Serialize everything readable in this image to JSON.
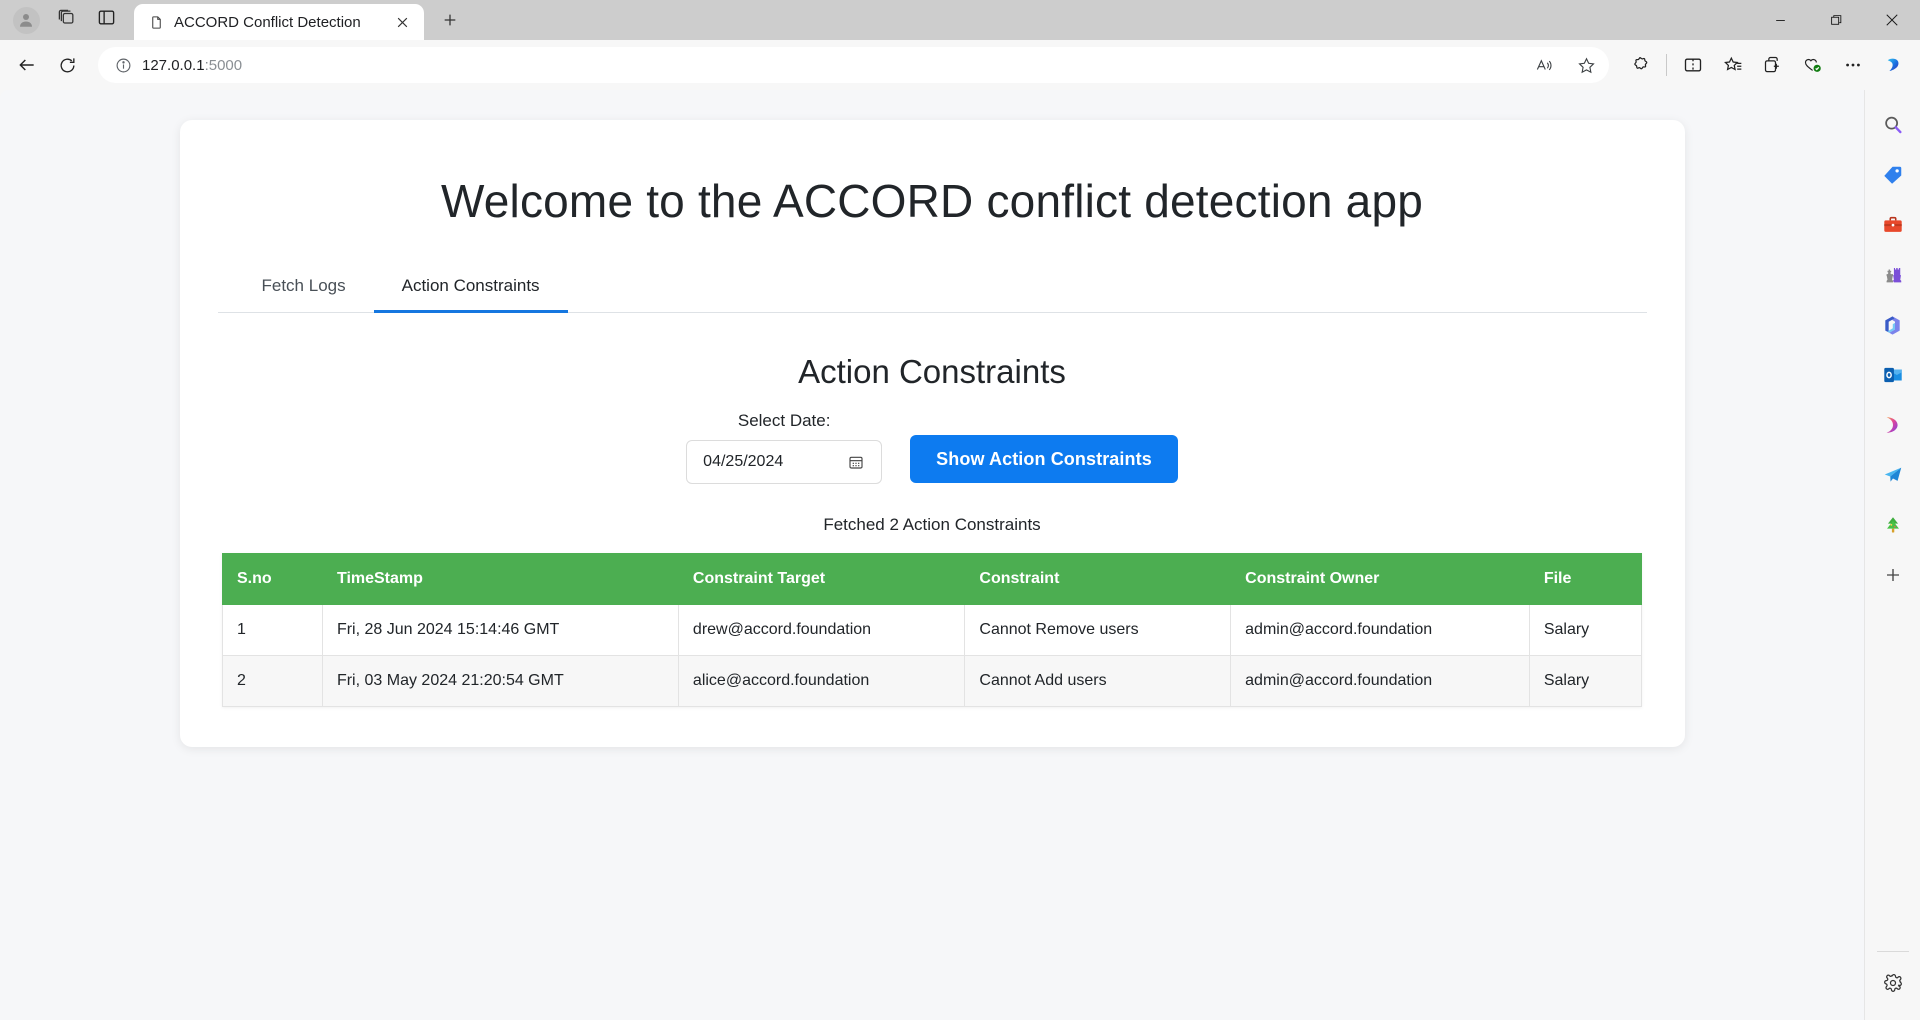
{
  "browser": {
    "window_controls": {
      "minimize": "minimize-icon",
      "restore": "restore-icon",
      "close": "close-icon"
    },
    "tab": {
      "title": "ACCORD Conflict Detection",
      "favicon": "page-icon",
      "close": "close-icon"
    },
    "new_tab": "+",
    "left_chips": [
      "profile-avatar-icon",
      "workspaces-icon",
      "tab-actions-icon"
    ],
    "nav": {
      "back": "back-arrow-icon",
      "refresh": "refresh-icon"
    },
    "address": {
      "url_main": "127.0.0.1",
      "url_port": ":5000",
      "info_icon": "site-info-icon"
    },
    "omnibox_actions": [
      "read-aloud-icon",
      "favorite-star-icon"
    ],
    "toolbar_actions": [
      "copilot-puzzle-icon",
      "split-screen-icon",
      "favorites-icon",
      "collections-icon",
      "browser-essentials-icon",
      "settings-more-icon",
      "copilot-icon"
    ],
    "edge_sidebar": [
      "search-icon",
      "shopping-tag-icon",
      "tools-briefcase-icon",
      "games-chess-icon",
      "microsoft-365-icon",
      "outlook-icon",
      "designer-icon",
      "telegram-send-icon",
      "tree-icon",
      "add-sidebar-icon",
      "settings-gear-icon"
    ]
  },
  "page": {
    "welcome_title": "Welcome to the ACCORD conflict detection app",
    "tabs": [
      {
        "label": "Fetch Logs",
        "active": false
      },
      {
        "label": "Action Constraints",
        "active": true
      }
    ],
    "section_title": "Action Constraints",
    "date_label": "Select Date:",
    "date_value": "04/25/2024",
    "date_icon": "calendar-icon",
    "show_button": "Show Action Constraints",
    "status_text": "Fetched 2 Action Constraints",
    "table": {
      "headers": [
        "S.no",
        "TimeStamp",
        "Constraint Target",
        "Constraint",
        "Constraint Owner",
        "File"
      ],
      "rows": [
        {
          "sno": "1",
          "timestamp": "Fri, 28 Jun 2024 15:14:46 GMT",
          "target": "drew@accord.foundation",
          "constraint": "Cannot Remove users",
          "owner": "admin@accord.foundation",
          "file": "Salary"
        },
        {
          "sno": "2",
          "timestamp": "Fri, 03 May 2024 21:20:54 GMT",
          "target": "alice@accord.foundation",
          "constraint": "Cannot Add users",
          "owner": "admin@accord.foundation",
          "file": "Salary"
        }
      ]
    }
  },
  "colors": {
    "accent_blue": "#0d7bf0",
    "table_header_green": "#4cae51",
    "page_background": "#f6f7f9",
    "tab_underline": "#1577e0"
  }
}
